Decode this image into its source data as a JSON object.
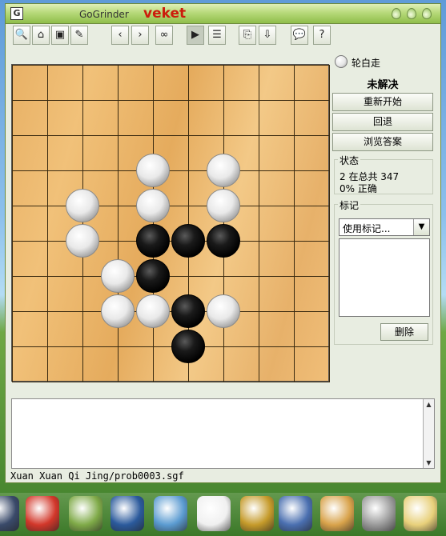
{
  "window": {
    "title": "GoGrinder",
    "theme_name": "veket"
  },
  "toolbar": {
    "buttons": [
      {
        "id": "magnifier",
        "glyph": "🔍"
      },
      {
        "id": "open",
        "glyph": "⌂"
      },
      {
        "id": "save",
        "glyph": "▣"
      },
      {
        "id": "edit",
        "glyph": "✎"
      },
      {
        "id": "previous",
        "glyph": "‹"
      },
      {
        "id": "next",
        "glyph": "›"
      },
      {
        "id": "binoculars",
        "glyph": "∞"
      },
      {
        "id": "play",
        "glyph": "▶"
      },
      {
        "id": "list",
        "glyph": "☰"
      },
      {
        "id": "copy",
        "glyph": "⎘"
      },
      {
        "id": "import",
        "glyph": "⇩"
      },
      {
        "id": "comment",
        "glyph": "💬"
      },
      {
        "id": "help",
        "glyph": "?"
      }
    ]
  },
  "board": {
    "size_shown": "9x9",
    "white_stones": [
      [
        4,
        3
      ],
      [
        6,
        3
      ],
      [
        2,
        4
      ],
      [
        4,
        4
      ],
      [
        6,
        4
      ],
      [
        2,
        5
      ],
      [
        3,
        6
      ],
      [
        3,
        7
      ],
      [
        4,
        7
      ],
      [
        6,
        7
      ]
    ],
    "black_stones": [
      [
        4,
        5
      ],
      [
        5,
        5
      ],
      [
        6,
        5
      ],
      [
        4,
        6
      ],
      [
        5,
        7
      ],
      [
        5,
        8
      ]
    ]
  },
  "side_panel": {
    "turn_label": "轮白走",
    "problem_status": "未解决",
    "restart_label": "重新开始",
    "back_label": "回退",
    "browse_answer_label": "浏览答案",
    "status_group_title": "状态",
    "status_progress": "2 在总共 347",
    "status_correct": "0% 正确",
    "marks_group_title": "标记",
    "marks_dropdown_value": "使用标记...",
    "delete_label": "删除"
  },
  "status_bar": {
    "file_path": "Xuan Xuan Qi Jing/prob0003.sgf"
  },
  "taskbar": {
    "icons": [
      "monitor-icon",
      "pig-icon",
      "notepad-icon",
      "media-player-icon",
      "chat-icon",
      "penguin-icon",
      "address-book-icon",
      "presentation-icon",
      "paint-icon",
      "usb-icon",
      "calendar-icon"
    ]
  }
}
